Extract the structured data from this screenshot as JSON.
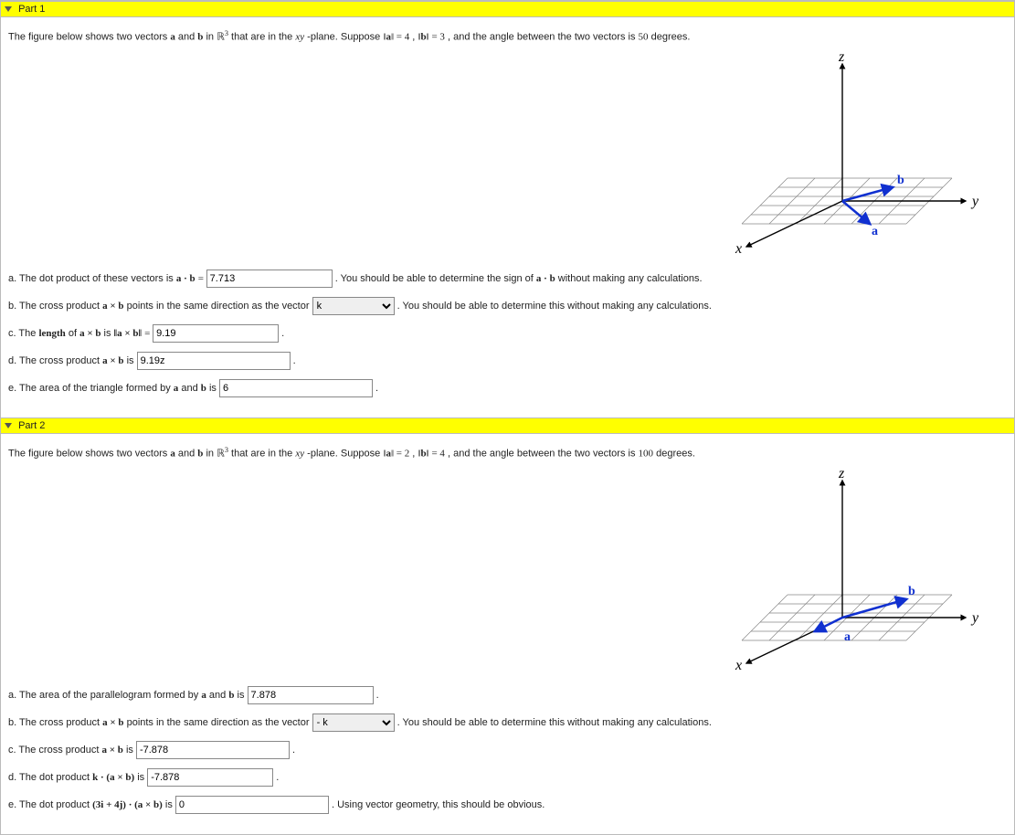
{
  "part1": {
    "header": "Part 1",
    "intro": {
      "t1": "The figure below shows two vectors ",
      "a": "a",
      "and": " and ",
      "b": "b",
      "t2": " in ",
      "R": "ℝ",
      "exp": "3",
      "t3": " that are in the ",
      "xy": "xy",
      "t4": "-plane. Suppose ",
      "na1": "‖",
      "na2": "a",
      "na3": "‖ = 4",
      "comma": ", ",
      "nb1": "‖",
      "nb2": "b",
      "nb3": "‖ = 3",
      "t5": ", and the angle between the two vectors is ",
      "deg": "50",
      "t6": " degrees."
    },
    "qa": {
      "pre": "a. The dot product of these vectors is ",
      "ab": "a · b",
      "eq": " = ",
      "val": "7.713",
      "post": ". You should be able to determine the sign of ",
      "ab2": "a · b",
      "post2": " without making any calculations."
    },
    "qb": {
      "pre": "b. The cross product ",
      "axb": "a × b",
      "mid": " points in the same direction as the vector ",
      "val": "k",
      "post": ". You should be able to determine this without making any calculations."
    },
    "qc": {
      "pre": "c. The ",
      "len": "length",
      "mid": " of ",
      "axb": "a × b",
      "is": " is ",
      "norm": "‖a × b‖",
      "eq": " = ",
      "val": "9.19",
      "post": "."
    },
    "qd": {
      "pre": "d. The cross product ",
      "axb": "a × b",
      "is": " is ",
      "val": "9.19z",
      "post": "."
    },
    "qe": {
      "pre": "e. The area of the triangle formed by ",
      "a": "a",
      "and": " and ",
      "b": "b",
      "is": " is ",
      "val": "6",
      "post": "."
    }
  },
  "part2": {
    "header": "Part 2",
    "intro": {
      "t1": "The figure below shows two vectors ",
      "a": "a",
      "and": " and ",
      "b": "b",
      "t2": " in ",
      "R": "ℝ",
      "exp": "3",
      "t3": " that are in the ",
      "xy": "xy",
      "t4": "-plane. Suppose ",
      "na1": "‖",
      "na2": "a",
      "na3": "‖ = 2",
      "comma": ", ",
      "nb1": "‖",
      "nb2": "b",
      "nb3": "‖ = 4",
      "t5": ", and the angle between the two vectors is ",
      "deg": "100",
      "t6": " degrees."
    },
    "qa": {
      "pre": "a. The area of the parallelogram formed by ",
      "a": "a",
      "and": " and ",
      "b": "b",
      "is": " is ",
      "val": "7.878",
      "post": "."
    },
    "qb": {
      "pre": "b. The cross product ",
      "axb": "a × b",
      "mid": " points in the same direction as the vector ",
      "val": "- k",
      "post": ". You should be able to determine this without making any calculations."
    },
    "qc": {
      "pre": "c. The cross product ",
      "axb": "a × b",
      "is": " is ",
      "val": "-7.878",
      "post": "."
    },
    "qd": {
      "pre": "d. The dot product ",
      "kdot": "k · (a × b)",
      "is": " is ",
      "val": "-7.878",
      "post": "."
    },
    "qe": {
      "pre": "e. The dot product ",
      "expr": "(3i + 4j) · (a × b)",
      "is": " is ",
      "val": "0",
      "post": ". Using vector geometry, this should be obvious."
    }
  },
  "axes": {
    "x": "x",
    "y": "y",
    "z": "z",
    "a": "a",
    "b": "b"
  },
  "chart_data": [
    {
      "type": "diagram",
      "title": "Part 1 vectors in xy-plane",
      "axes": [
        "x",
        "y",
        "z"
      ],
      "vectors": [
        {
          "name": "a",
          "magnitude": 4,
          "plane": "xy"
        },
        {
          "name": "b",
          "magnitude": 3,
          "plane": "xy"
        }
      ],
      "angle_between_deg": 50
    },
    {
      "type": "diagram",
      "title": "Part 2 vectors in xy-plane",
      "axes": [
        "x",
        "y",
        "z"
      ],
      "vectors": [
        {
          "name": "a",
          "magnitude": 2,
          "plane": "xy"
        },
        {
          "name": "b",
          "magnitude": 4,
          "plane": "xy"
        }
      ],
      "angle_between_deg": 100
    }
  ]
}
